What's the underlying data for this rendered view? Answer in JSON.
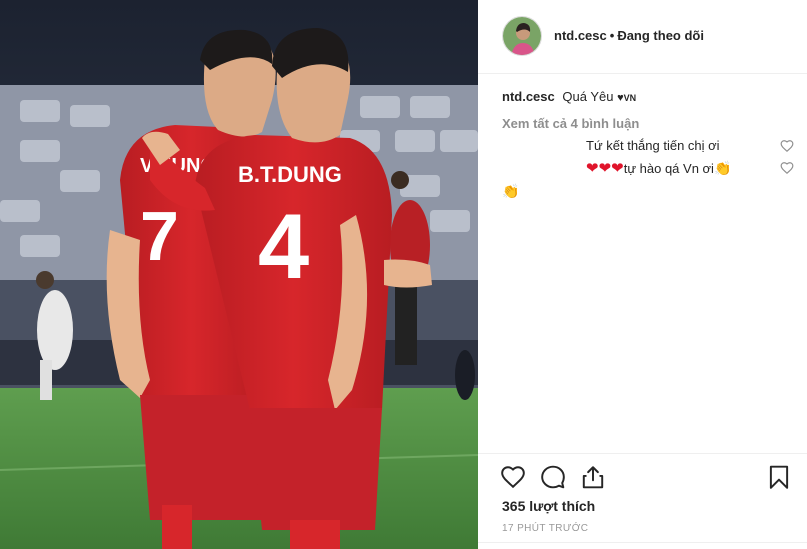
{
  "post": {
    "photo_icon": "soccer-players-photo",
    "header": {
      "username": "ntd.cesc",
      "separator": "•",
      "follow_label": "Đang theo dõi",
      "avatar_icon": "avatar"
    },
    "caption": {
      "username": "ntd.cesc",
      "text": "Quá Yêu",
      "heart": "♥",
      "flag_text": "VN"
    },
    "view_all_comments": "Xem tất cả 4 bình luận",
    "comments": [
      {
        "text": "Tứ kết thắng tiến chị ơi",
        "like_icon": "heart-outline-icon"
      },
      {
        "hearts": "❤❤❤",
        "text": "tự hào qá Vn ơi",
        "emoji": "👏",
        "like_icon": "heart-outline-icon"
      },
      {
        "emoji": "👏"
      }
    ],
    "actions": {
      "like_icon": "heart-outline-icon",
      "comment_icon": "comment-bubble-icon",
      "share_icon": "share-icon",
      "save_icon": "bookmark-icon"
    },
    "likes": "365 lượt thích",
    "timestamp": "17 PHÚT TRƯỚC"
  },
  "jerseys": {
    "left": "HUNG",
    "left_partial": "V.HUNG",
    "right_name": "B.T.DUNG",
    "right_number": "4"
  },
  "colors": {
    "jersey_red": "#d7262b",
    "text_primary": "#262626",
    "text_secondary": "#8e8e8e",
    "heart_red": "#e0142b"
  }
}
